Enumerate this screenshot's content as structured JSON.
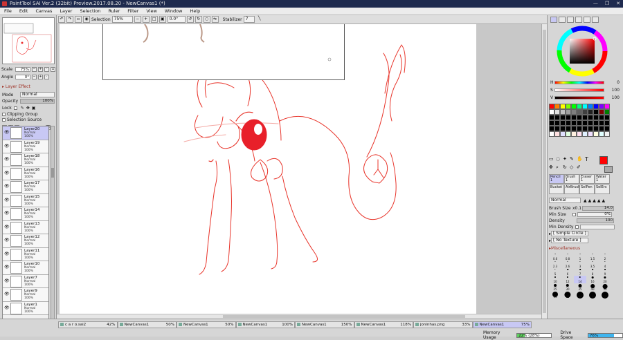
{
  "window": {
    "title": "PaintTool SAI Ver.2 (32bit) Preview.2017.08.20 - NewCanvas1 (*)",
    "controls": [
      "—",
      "❐",
      "✕"
    ]
  },
  "menu": [
    "File",
    "Edit",
    "Canvas",
    "Layer",
    "Selection",
    "Ruler",
    "Filter",
    "View",
    "Window",
    "Help"
  ],
  "toolbar": {
    "selection_label": "Selection",
    "zoom": "75%",
    "angle": "0.0°",
    "stabilizer_label": "Stabilizer",
    "stabilizer_value": "7"
  },
  "navigator": {
    "scale_label": "Scale",
    "scale_value": "75%",
    "angle_label": "Angle",
    "angle_value": "0°"
  },
  "layer_effect": {
    "title": "Layer Effect",
    "mode_label": "Mode",
    "mode_value": "Normal",
    "opacity_label": "Opacity",
    "opacity_value": "100%",
    "lock_label": "Lock",
    "clipping_label": "Clipping Group",
    "selection_source_label": "Selection Source"
  },
  "layers": [
    {
      "name": "Layer20",
      "mode": "Normal",
      "opacity": "100%",
      "selected": true
    },
    {
      "name": "Layer19",
      "mode": "Normal",
      "opacity": "100%"
    },
    {
      "name": "Layer18",
      "mode": "Normal",
      "opacity": "100%"
    },
    {
      "name": "Layer16",
      "mode": "Normal",
      "opacity": "100%"
    },
    {
      "name": "Layer17",
      "mode": "Normal",
      "opacity": "100%"
    },
    {
      "name": "Layer15",
      "mode": "Normal",
      "opacity": "100%"
    },
    {
      "name": "Layer14",
      "mode": "Normal",
      "opacity": "100%"
    },
    {
      "name": "Layer13",
      "mode": "Normal",
      "opacity": "100%"
    },
    {
      "name": "Layer12",
      "mode": "Normal",
      "opacity": "100%"
    },
    {
      "name": "Layer11",
      "mode": "Normal",
      "opacity": "100%"
    },
    {
      "name": "Layer10",
      "mode": "Normal",
      "opacity": "100%"
    },
    {
      "name": "Layer7",
      "mode": "Normal",
      "opacity": "100%"
    },
    {
      "name": "Layer9",
      "mode": "Normal",
      "opacity": "100%"
    },
    {
      "name": "Layer1",
      "mode": "Normal",
      "opacity": "100%"
    }
  ],
  "color": {
    "h_label": "H",
    "h_value": "0",
    "s_label": "S",
    "s_value": "100",
    "v_label": "V",
    "v_value": "100",
    "current": "#ff0000"
  },
  "swatches": [
    "#ff0000",
    "#ff7f00",
    "#ffff00",
    "#7fff00",
    "#00ff00",
    "#00ff7f",
    "#00ffff",
    "#007fff",
    "#0000ff",
    "#7f00ff",
    "#ff00ff",
    "#ffffff",
    "#e0e0e0",
    "#c0c0c0",
    "#a0a0a0",
    "#808080",
    "#606060",
    "#404040",
    "#202020",
    "#000000",
    "#7f0000",
    "#007f00",
    "#000000",
    "#000000",
    "#000000",
    "#000000",
    "#000000",
    "#000000",
    "#000000",
    "#000000",
    "#000000",
    "#000000",
    "#000000",
    "#000000",
    "#000000",
    "#000000",
    "#000000",
    "#000000",
    "#000000",
    "#000000",
    "#000000",
    "#000000",
    "#000000",
    "#000000",
    "#000000",
    "#000000",
    "#000000",
    "#000000",
    "#000000",
    "#000000",
    "#000000",
    "#000000",
    "#000000",
    "#000000",
    "#000000",
    "#ffffff",
    "#ffe0e0",
    "#e0e0ff",
    "#e0ffe0",
    "#fff0e0",
    "#ffe0f0",
    "#e0f0ff",
    "#f0e0ff",
    "#ffffe0",
    "#e0ffff",
    "#f0f0f0"
  ],
  "tools": [
    {
      "name": "Pencil",
      "size": "1",
      "selected": true
    },
    {
      "name": "Brush",
      "size": "1"
    },
    {
      "name": "Eraser",
      "size": "1"
    },
    {
      "name": "Water",
      "size": "1"
    },
    {
      "name": "Bucket",
      "size": ""
    },
    {
      "name": "AirBrush",
      "size": ""
    },
    {
      "name": "SelPen",
      "size": ""
    },
    {
      "name": "SelErs",
      "size": ""
    }
  ],
  "brush": {
    "blend": "Normal",
    "size_label": "Brush Size",
    "size_mult": "x0.1",
    "size_value": "14.0",
    "min_size_label": "Min Size",
    "min_size_value": "0%",
    "density_label": "Density",
    "density_value": "100",
    "min_density_label": "Min Density",
    "min_density_value": "",
    "shape": "[ Simple Circle ]",
    "texture": "[ No Texture ]",
    "misc": "Miscellaneous"
  },
  "brush_sizes": [
    "0.6",
    "0.8",
    "1",
    "1.5",
    "2",
    "2.3",
    "2.6",
    "3",
    "3.5",
    "4",
    "5",
    "6",
    "7",
    "8",
    "9",
    "10",
    "12",
    "14",
    "16",
    "20",
    "25",
    "30",
    "35",
    "40",
    "50",
    "60",
    "70",
    "80",
    "100",
    "120"
  ],
  "documents": [
    {
      "name": "c a r o.sai2",
      "zoom": "42%"
    },
    {
      "name": "NewCanvas1",
      "zoom": "50%"
    },
    {
      "name": "NewCanvas1",
      "zoom": "50%"
    },
    {
      "name": "NewCanvas1",
      "zoom": "100%"
    },
    {
      "name": "NewCanvas1",
      "zoom": "150%"
    },
    {
      "name": "NewCanvas1",
      "zoom": "118%"
    },
    {
      "name": "joninhas.png",
      "zoom": "33%"
    },
    {
      "name": "NewCanvas1",
      "zoom": "75%",
      "selected": true
    }
  ],
  "status": {
    "memory_label": "Memory Usage",
    "memory_value": "22% (28%)",
    "memory_pct": 22,
    "drive_label": "Drive Space",
    "drive_value": "76%",
    "drive_pct": 76
  }
}
